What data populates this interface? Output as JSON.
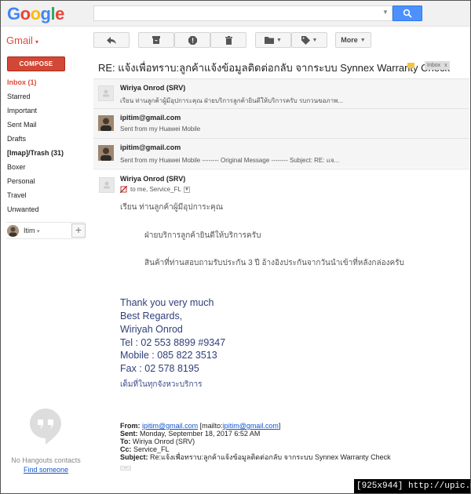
{
  "header": {
    "logo": "Google",
    "search_placeholder": "",
    "search_icon": "magnifier-icon"
  },
  "app": {
    "name": "Gmail"
  },
  "toolbar": {
    "buttons": [
      "reply-icon",
      "archive-icon",
      "report-spam-icon",
      "delete-icon",
      "folder-icon",
      "label-icon"
    ],
    "more_label": "More"
  },
  "sidebar": {
    "compose_label": "COMPOSE",
    "items": [
      {
        "label": "Inbox (1)",
        "active": true
      },
      {
        "label": "Starred"
      },
      {
        "label": "Important"
      },
      {
        "label": "Sent Mail"
      },
      {
        "label": "Drafts"
      },
      {
        "label": "[Imap]/Trash (31)",
        "bold": true
      },
      {
        "label": "Boxer"
      },
      {
        "label": "Personal"
      },
      {
        "label": "Travel"
      },
      {
        "label": "Unwanted"
      }
    ],
    "user_name": "Itim",
    "no_contacts": "No Hangouts contacts",
    "find_someone": "Find someone"
  },
  "thread": {
    "subject": "RE: แจ้งเพื่อทราบ:ลูกค้าแจ้งข้อมูลติดต่อกลับ จากระบบ Synnex Warranty Check",
    "badge": "Inbox",
    "badge_close": "x",
    "messages": [
      {
        "sender": "Wiriya Onrod (SRV)",
        "snippet": "เรียน ท่านลูกค้าผู้มีอุปการะคุณ ฝ่ายบริการลูกค้ายินดีให้บริการครับ รบกวนขอภาพ..."
      },
      {
        "sender": "ipitim@gmail.com",
        "snippet": "Sent from my Huawei Mobile"
      },
      {
        "sender": "ipitim@gmail.com",
        "snippet": "Sent from my Huawei Mobile -------- Original Message -------- Subject: RE: แจ..."
      }
    ],
    "open": {
      "sender": "Wiriya Onrod (SRV)",
      "to": "to me, Service_FL",
      "greeting": "เรียน ท่านลูกค้าผู้มีอุปการะคุณ",
      "line1": "ฝ่ายบริการลูกค้ายินดีให้บริการครับ",
      "line2": "สินค้าที่ท่านสอบถามรับประกัน 3 ปี อ้างอิงประกันจากวันนำเข้าที่หลังกล่องครับ",
      "signature": [
        "Thank you very much",
        "Best Regards,",
        "Wiriyah Onrod",
        "Tel : 02 553 8899 #9347",
        "Mobile : 085 822 3513",
        "Fax : 02 578 8195"
      ],
      "tagline": "เต็มที่ในทุกจังหวะบริการ",
      "quote": {
        "from_label": "From:",
        "from_email": "ipitim@gmail.com",
        "from_mailto_pre": " [mailto:",
        "from_mailto": "ipitim@gmail.com",
        "from_mailto_post": "]",
        "sent_label": "Sent:",
        "sent_value": " Monday, September 18, 2017 6:52 AM",
        "to_label": "To:",
        "to_value": " Wiriya Onrod (SRV)",
        "cc_label": "Cc:",
        "cc_value": " Service_FL",
        "subject_label": "Subject:",
        "subject_value": " Re:แจ้งเพื่อทราบ:ลูกค้าแจ้งข้อมูลติดต่อกลับ จากระบบ Synnex Warranty Check"
      },
      "ellipsis": "..."
    }
  },
  "watermark": "[925x944] http://upic.me/",
  "colors": {
    "google_blue": "#4285f4",
    "google_red": "#ea4335",
    "google_yellow": "#fbbc05",
    "google_green": "#34a853",
    "compose_red": "#d14836",
    "signature_blue": "#2f3f7a",
    "link_blue": "#1155cc"
  }
}
